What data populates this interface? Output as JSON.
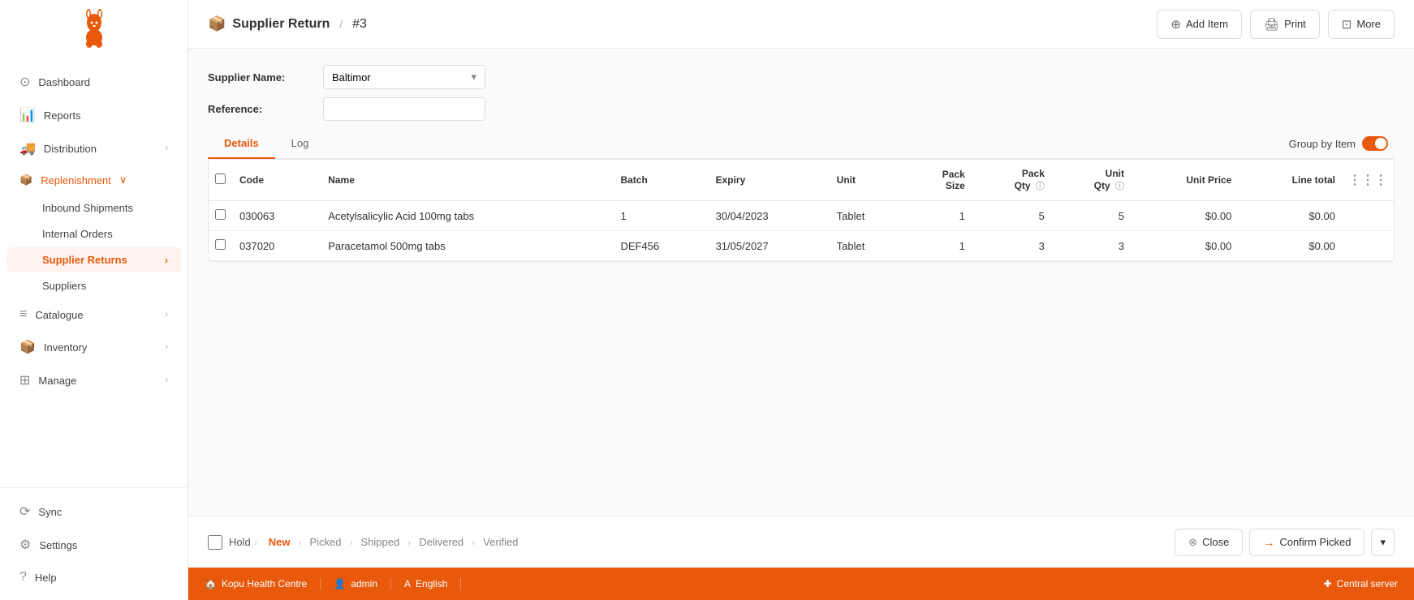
{
  "app": {
    "title": "Supplier Return",
    "number": "#3",
    "breadcrumb_icon": "📦"
  },
  "header": {
    "add_item_label": "Add Item",
    "print_label": "Print",
    "more_label": "More"
  },
  "form": {
    "supplier_name_label": "Supplier Name:",
    "supplier_name_value": "Baltimor",
    "reference_label": "Reference:",
    "reference_value": ""
  },
  "group_by_toggle": {
    "label": "Group by Item"
  },
  "tabs": [
    {
      "id": "details",
      "label": "Details",
      "active": true
    },
    {
      "id": "log",
      "label": "Log",
      "active": false
    }
  ],
  "table": {
    "columns": [
      {
        "id": "code",
        "label": "Code"
      },
      {
        "id": "name",
        "label": "Name"
      },
      {
        "id": "batch",
        "label": "Batch"
      },
      {
        "id": "expiry",
        "label": "Expiry"
      },
      {
        "id": "unit",
        "label": "Unit"
      },
      {
        "id": "pack_size",
        "label": "Pack\nSize"
      },
      {
        "id": "pack_qty",
        "label": "Pack\nQty",
        "has_info": true
      },
      {
        "id": "unit_qty",
        "label": "Unit\nQty",
        "has_info": true
      },
      {
        "id": "unit_price",
        "label": "Unit Price"
      },
      {
        "id": "line_total",
        "label": "Line total"
      }
    ],
    "rows": [
      {
        "id": 1,
        "code": "030063",
        "name": "Acetylsalicylic Acid 100mg tabs",
        "batch": "1",
        "expiry": "30/04/2023",
        "unit": "Tablet",
        "pack_size": "1",
        "pack_qty": "5",
        "unit_qty": "5",
        "unit_price": "$0.00",
        "line_total": "$0.00"
      },
      {
        "id": 2,
        "code": "037020",
        "name": "Paracetamol 500mg tabs",
        "batch": "DEF456",
        "expiry": "31/05/2027",
        "unit": "Tablet",
        "pack_size": "1",
        "pack_qty": "3",
        "unit_qty": "3",
        "unit_price": "$0.00",
        "line_total": "$0.00"
      }
    ]
  },
  "status_steps": [
    {
      "id": "hold",
      "label": "Hold",
      "type": "checkbox"
    },
    {
      "id": "new",
      "label": "New",
      "active": true
    },
    {
      "id": "picked",
      "label": "Picked",
      "active": false
    },
    {
      "id": "shipped",
      "label": "Shipped",
      "active": false
    },
    {
      "id": "delivered",
      "label": "Delivered",
      "active": false
    },
    {
      "id": "verified",
      "label": "Verified",
      "active": false
    }
  ],
  "actions": {
    "close_label": "Close",
    "confirm_picked_label": "Confirm Picked"
  },
  "sidebar": {
    "items": [
      {
        "id": "dashboard",
        "label": "Dashboard",
        "icon": "⊙",
        "has_chevron": false
      },
      {
        "id": "reports",
        "label": "Reports",
        "icon": "↻",
        "has_chevron": false
      },
      {
        "id": "distribution",
        "label": "Distribution",
        "icon": "🚚",
        "has_chevron": true,
        "expanded": false
      },
      {
        "id": "replenishment",
        "label": "Replenishment",
        "icon": "📦",
        "has_chevron": true,
        "expanded": true,
        "active": true
      },
      {
        "id": "catalogue",
        "label": "Catalogue",
        "icon": "≡",
        "has_chevron": true,
        "expanded": false
      },
      {
        "id": "inventory",
        "label": "Inventory",
        "icon": "📦",
        "has_chevron": true,
        "expanded": false
      },
      {
        "id": "manage",
        "label": "Manage",
        "icon": "⚙",
        "has_chevron": true,
        "expanded": false
      }
    ],
    "replenishment_sub": [
      {
        "id": "inbound-shipments",
        "label": "Inbound Shipments"
      },
      {
        "id": "internal-orders",
        "label": "Internal Orders"
      },
      {
        "id": "supplier-returns",
        "label": "Supplier Returns",
        "active": true
      },
      {
        "id": "suppliers",
        "label": "Suppliers"
      }
    ],
    "bottom_items": [
      {
        "id": "sync",
        "label": "Sync",
        "icon": "⟳"
      },
      {
        "id": "settings",
        "label": "Settings",
        "icon": "⚙"
      },
      {
        "id": "help",
        "label": "Help",
        "icon": "?"
      }
    ]
  },
  "footer": {
    "org": "Kopu Health Centre",
    "user": "admin",
    "language": "English",
    "server": "Central server"
  }
}
